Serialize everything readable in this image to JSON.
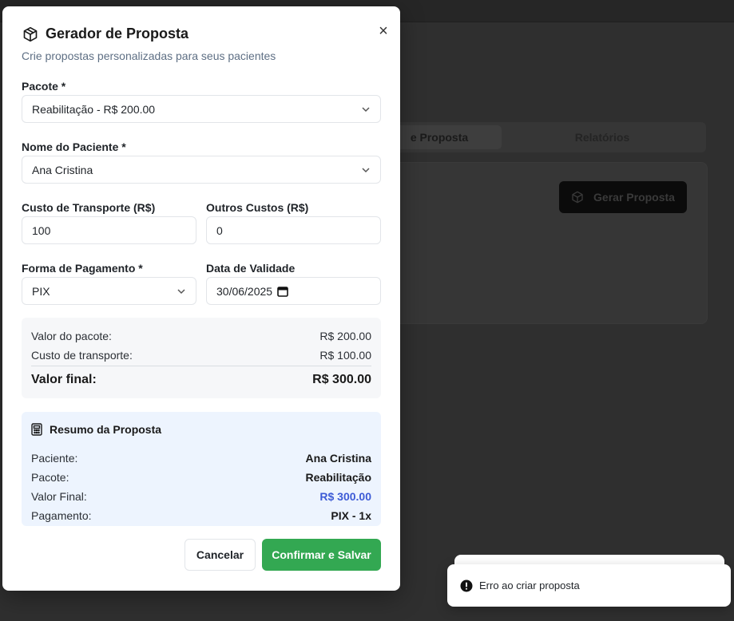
{
  "background": {
    "tabs": [
      "e Proposta",
      "Relatórios"
    ],
    "generate_button_label": "Gerar Proposta"
  },
  "modal": {
    "title": "Gerador de Proposta",
    "subtitle": "Crie propostas personalizadas para seus pacientes",
    "close_icon": "×",
    "fields": {
      "package": {
        "label": "Pacote *",
        "value": "Reabilitação - R$ 200.00"
      },
      "patient": {
        "label": "Nome do Paciente *",
        "value": "Ana Cristina"
      },
      "transport": {
        "label": "Custo de Transporte (R$)",
        "value": "100"
      },
      "other_costs": {
        "label": "Outros Custos (R$)",
        "value": "0"
      },
      "payment": {
        "label": "Forma de Pagamento *",
        "value": "PIX"
      },
      "validity": {
        "label": "Data de Validade",
        "value": "30/06/2025"
      }
    },
    "totals": {
      "package_value_label": "Valor do pacote:",
      "package_value": "R$ 200.00",
      "transport_label": "Custo de transporte:",
      "transport_value": "R$ 100.00",
      "final_label": "Valor final:",
      "final_value": "R$ 300.00"
    },
    "summary": {
      "title": "Resumo da Proposta",
      "patient_label": "Paciente:",
      "patient_value": "Ana Cristina",
      "package_label": "Pacote:",
      "package_value": "Reabilitação",
      "final_label": "Valor Final:",
      "final_value": "R$ 300.00",
      "payment_label": "Pagamento:",
      "payment_value": "PIX - 1x"
    },
    "buttons": {
      "cancel": "Cancelar",
      "confirm": "Confirmar e Salvar"
    }
  },
  "toast": {
    "message": "Erro ao criar proposta"
  },
  "colors": {
    "confirm": "#33a852",
    "highlight": "#3d5bd6",
    "summary_bg": "#edf4fe"
  }
}
